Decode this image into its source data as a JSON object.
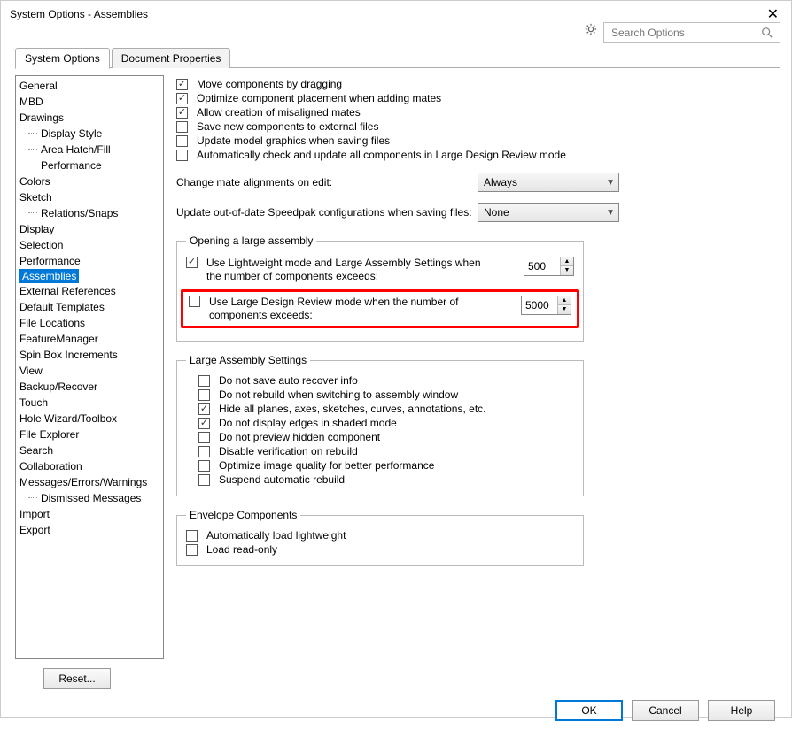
{
  "window": {
    "title": "System Options - Assemblies"
  },
  "search": {
    "placeholder": "Search Options"
  },
  "tabs": {
    "system_options": "System Options",
    "document_properties": "Document Properties"
  },
  "sidebar": {
    "items": [
      {
        "label": "General"
      },
      {
        "label": "MBD"
      },
      {
        "label": "Drawings"
      },
      {
        "label": "Display Style",
        "child": true
      },
      {
        "label": "Area Hatch/Fill",
        "child": true
      },
      {
        "label": "Performance",
        "child": true
      },
      {
        "label": "Colors"
      },
      {
        "label": "Sketch"
      },
      {
        "label": "Relations/Snaps",
        "child": true
      },
      {
        "label": "Display"
      },
      {
        "label": "Selection"
      },
      {
        "label": "Performance"
      },
      {
        "label": "Assemblies",
        "selected": true
      },
      {
        "label": "External References"
      },
      {
        "label": "Default Templates"
      },
      {
        "label": "File Locations"
      },
      {
        "label": "FeatureManager"
      },
      {
        "label": "Spin Box Increments"
      },
      {
        "label": "View"
      },
      {
        "label": "Backup/Recover"
      },
      {
        "label": "Touch"
      },
      {
        "label": "Hole Wizard/Toolbox"
      },
      {
        "label": "File Explorer"
      },
      {
        "label": "Search"
      },
      {
        "label": "Collaboration"
      },
      {
        "label": "Messages/Errors/Warnings"
      },
      {
        "label": "Dismissed Messages",
        "child": true
      },
      {
        "label": "Import"
      },
      {
        "label": "Export"
      }
    ]
  },
  "top_checks": {
    "c0": "Move components by dragging",
    "c1": "Optimize component placement when adding mates",
    "c2": "Allow creation of misaligned mates",
    "c3": "Save new components to external files",
    "c4": "Update model graphics when saving files",
    "c5": "Automatically check and update all components in Large Design Review mode"
  },
  "selects": {
    "mate_label": "Change mate alignments on edit:",
    "mate_value": "Always",
    "speedpak_label": "Update out-of-date Speedpak configurations when saving files:",
    "speedpak_value": "None"
  },
  "group_open": {
    "legend": "Opening a large assembly",
    "opt0": "Use Lightweight mode and Large Assembly Settings when the number of components exceeds:",
    "opt0_val": "500",
    "opt1": "Use Large Design Review mode when the number of components exceeds:",
    "opt1_val": "5000"
  },
  "group_large": {
    "legend": "Large Assembly Settings",
    "l0": "Do not save auto recover info",
    "l1": "Do not rebuild when switching to assembly window",
    "l2": "Hide all planes, axes, sketches, curves, annotations, etc.",
    "l3": "Do not display edges in shaded mode",
    "l4": "Do not preview hidden component",
    "l5": "Disable verification on rebuild",
    "l6": "Optimize image quality for better performance",
    "l7": "Suspend automatic rebuild"
  },
  "group_env": {
    "legend": "Envelope Components",
    "e0": "Automatically load lightweight",
    "e1": "Load read-only"
  },
  "buttons": {
    "reset": "Reset...",
    "ok": "OK",
    "cancel": "Cancel",
    "help": "Help"
  }
}
